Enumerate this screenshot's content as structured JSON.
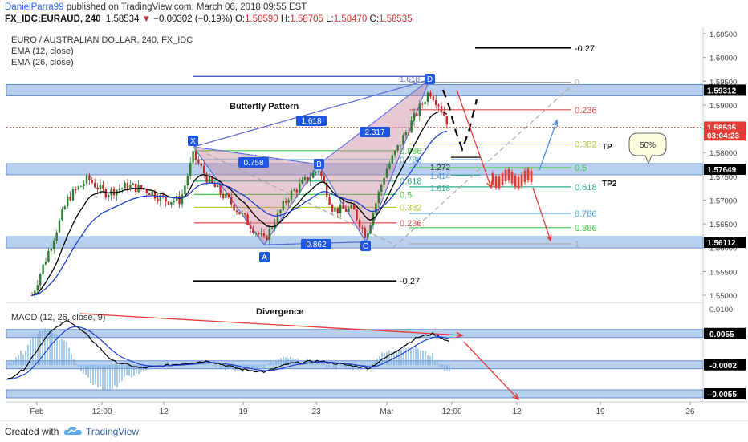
{
  "header": {
    "author": "DanielParra99",
    "published": "published on TradingView.com, March 06, 2018 09:55 EST",
    "symbol": "FX_IDC:EURAUD, 240",
    "last": "1.58534",
    "change": "−0.00302 (−0.19%)",
    "o_label": "O:",
    "o": "1.58590",
    "h_label": "H:",
    "h": "1.58705",
    "l_label": "L:",
    "l": "1.58470",
    "c_label": "C:",
    "c": "1.58535"
  },
  "legend": {
    "title": "EURO / AUSTRALIAN DOLLAR, 240, FX_IDC",
    "ema12": "EMA (12, close)",
    "ema26": "EMA (26, close)",
    "macd": "MACD (12, 26, close, 9)"
  },
  "annotations": {
    "pattern_title": "Butterfly Pattern",
    "divergence": "Divergence",
    "badge_50": "50%",
    "tp": "TP",
    "tp2": "TP2",
    "point_x": "X",
    "point_a": "A",
    "point_b": "B",
    "point_c": "C",
    "point_d": "D",
    "ratio_xa": "0.758",
    "ratio_ac": "0.862",
    "ratio_bd": "2.317",
    "ratio_xd": "1.618",
    "d_level": "1.618",
    "proj_1272": "1.272",
    "proj_1414": "1.414",
    "proj_1618": "1.618"
  },
  "left_fib": [
    {
      "label": "0.886",
      "value": 1.5804,
      "color": "#43c743"
    },
    {
      "label": "0.786",
      "value": 1.5785,
      "color": "#4a9fd8"
    },
    {
      "label": "0.618",
      "value": 1.574,
      "color": "#2fae8f"
    },
    {
      "label": "0.5",
      "value": 1.5712,
      "color": "#43c743"
    },
    {
      "label": "0.382",
      "value": 1.5685,
      "color": "#b5c93a"
    },
    {
      "label": "0.236",
      "value": 1.5652,
      "color": "#e04a4a"
    },
    {
      "label": "-0.27",
      "value": 1.553,
      "color": "#000000"
    }
  ],
  "right_fib": [
    {
      "label": "-0.27",
      "value": 1.602,
      "color": "#000000"
    },
    {
      "label": "0",
      "value": 1.5948,
      "color": "#aaaaaa"
    },
    {
      "label": "0.236",
      "value": 1.589,
      "color": "#e04a4a"
    },
    {
      "label": "0.382",
      "value": 1.5818,
      "color": "#b5c93a"
    },
    {
      "label": "0.5",
      "value": 1.5768,
      "color": "#43c743"
    },
    {
      "label": "0.618",
      "value": 1.5728,
      "color": "#2fae8f"
    },
    {
      "label": "0.786",
      "value": 1.5672,
      "color": "#4a9fd8"
    },
    {
      "label": "0.886",
      "value": 1.5642,
      "color": "#43c743"
    },
    {
      "label": "1",
      "value": 1.5608,
      "color": "#aaaaaa"
    }
  ],
  "price_axis": {
    "ticks": [
      "1.60500",
      "1.60000",
      "1.59500",
      "1.59000",
      "1.58500",
      "1.58000",
      "1.57500",
      "1.57000",
      "1.56500",
      "1.56000",
      "1.55500",
      "1.55000"
    ],
    "tick_values": [
      1.605,
      1.6,
      1.595,
      1.59,
      1.585,
      1.58,
      1.575,
      1.57,
      1.565,
      1.56,
      1.555,
      1.55
    ],
    "labels": [
      {
        "text": "1.59312",
        "value": 1.59312,
        "bg": "#000000",
        "fg": "#ffffff"
      },
      {
        "text": "1.58535",
        "value": 1.58535,
        "bg": "#e53935",
        "fg": "#ffffff"
      },
      {
        "text": "03:04:23",
        "value": 1.5837,
        "bg": "#e53935",
        "fg": "#ffffff"
      },
      {
        "text": "1.57649",
        "value": 1.57649,
        "bg": "#000000",
        "fg": "#ffffff"
      },
      {
        "text": "1.56112",
        "value": 1.56112,
        "bg": "#000000",
        "fg": "#ffffff"
      }
    ]
  },
  "macd_axis": {
    "ticks": [
      "0.0100"
    ],
    "labels": [
      {
        "text": "0.0055",
        "value": 0.0055
      },
      {
        "text": "-0.0002",
        "value": -0.0002
      },
      {
        "text": "-0.0055",
        "value": -0.0055
      }
    ]
  },
  "time_axis": [
    "Feb",
    "12:00",
    "12",
    "19",
    "23",
    "Mar",
    "12:00",
    "12",
    "19",
    "26"
  ],
  "colors": {
    "up": "#2e7d32",
    "down": "#c62828",
    "ema12": "#000000",
    "ema26": "#1e3fd0",
    "zone": "#7ea9e0",
    "pattern": "#c9879e",
    "arrow_red": "#e53935",
    "arrow_blue": "#4a90e2"
  },
  "chart_data": {
    "type": "candlestick",
    "symbol": "EURAUD",
    "timeframe": "240",
    "ylim": [
      1.5475,
      1.6065
    ],
    "pattern_points": [
      {
        "label": "X",
        "value": 1.5812
      },
      {
        "label": "A",
        "value": 1.5606
      },
      {
        "label": "B",
        "value": 1.5775
      },
      {
        "label": "C",
        "value": 1.5612
      },
      {
        "label": "D",
        "value": 1.5953
      }
    ],
    "support_resistance": [
      1.59312,
      1.57649,
      1.56112
    ],
    "macd_levels": [
      0.0055,
      -0.0002,
      -0.0055
    ],
    "last_close": 1.58535
  }
}
